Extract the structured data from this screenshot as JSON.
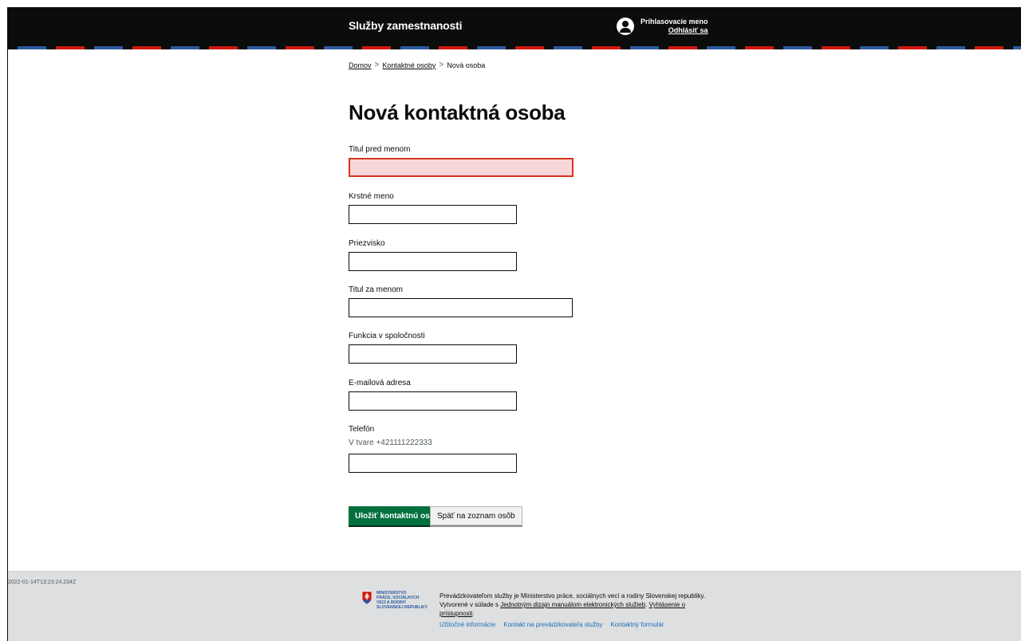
{
  "header": {
    "service_name": "Služby zamestnanosti",
    "login_label": "Prihlasovacie meno",
    "logout_label": "Odhlásiť sa"
  },
  "breadcrumb": {
    "items": [
      "Domov",
      "Kontaktné osoby",
      "Nová osoba"
    ],
    "separator": ">"
  },
  "page_title": "Nová kontaktná osoba",
  "form": {
    "fields": [
      {
        "label": "Titul pred menom",
        "value": "",
        "state": "error"
      },
      {
        "label": "Krstné meno",
        "value": ""
      },
      {
        "label": "Priezvisko",
        "value": ""
      },
      {
        "label": "Titul za menom",
        "value": ""
      },
      {
        "label": "Funkcia v spoločnosti",
        "value": ""
      },
      {
        "label": "E-mailová adresa",
        "value": ""
      },
      {
        "label": "Telefón",
        "hint": "V tvare +421111222333",
        "value": ""
      }
    ],
    "save_label": "Uložiť kontaktnú osobu",
    "back_label": "Späť na zoznam osôb"
  },
  "footer": {
    "timestamp": "2022-01-14T13:23:24.234Z",
    "ministry_lines": [
      "MINISTERSTVO",
      "PRÁCE, SOCIÁLNYCH",
      "VECÍ A RODINY",
      "SLOVENSKEJ REPUBLIKY"
    ],
    "text_part1": "Prevádzkovateľom služby je Ministerstvo práce, sociálnych vecí a rodiny Slovenskej republiky. Vytvorené v súlade s ",
    "link_manual": "Jednotným dizajn manuálom elektronických služieb",
    "text_part2": ". ",
    "link_accessibility": "Vyhlásenie o prístupnosti",
    "text_part3": ".",
    "links": [
      "Užitočné informácie",
      "Kontakt na prevádzkovateľa služby",
      "Kontaktný formulár"
    ]
  },
  "colors": {
    "header_bg": "#0b0c0c",
    "primary_button": "#00703c",
    "error": "#d4351c",
    "footer_bg": "#dedfe0",
    "link": "#1d70b8"
  }
}
